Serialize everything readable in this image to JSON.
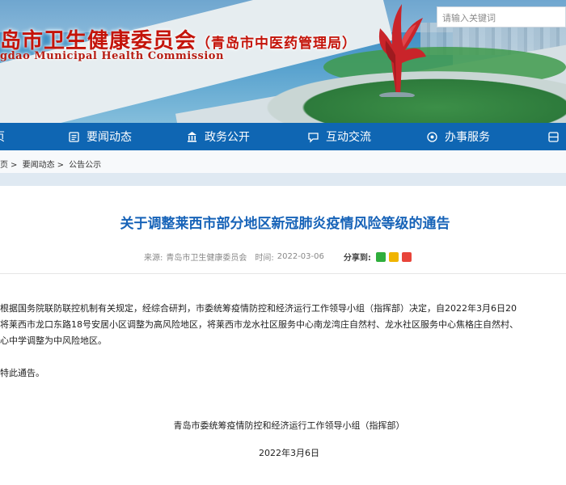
{
  "header": {
    "title_main": "岛市卫生健康委员会",
    "title_sub": "（青岛市中医药管理局）",
    "title_en": "gdao Municipal Health Commission",
    "search_placeholder": "请输入关键词"
  },
  "nav": {
    "items": [
      {
        "label": "页",
        "icon": "home-icon"
      },
      {
        "label": "要闻动态",
        "icon": "news-icon"
      },
      {
        "label": "政务公开",
        "icon": "gov-open-icon"
      },
      {
        "label": "互动交流",
        "icon": "chat-icon"
      },
      {
        "label": "办事服务",
        "icon": "service-icon"
      }
    ]
  },
  "breadcrumb": {
    "items": [
      "页",
      "要闻动态",
      "公告公示"
    ],
    "separator": ">"
  },
  "article": {
    "title": "关于调整莱西市部分地区新冠肺炎疫情风险等级的通告",
    "source_label": "来源:",
    "source": "青岛市卫生健康委员会",
    "time_label": "时间:",
    "time": "2022-03-06",
    "share_label": "分享到:",
    "share_icons": [
      "wechat-share-icon",
      "qzone-share-icon",
      "weibo-share-icon"
    ],
    "paragraph_lines": [
      "根据国务院联防联控机制有关规定，经综合研判，市委统筹疫情防控和经济运行工作领导小组（指挥部）决定，自2022年3月6日20",
      "将莱西市龙口东路18号安居小区调整为高风险地区，将莱西市龙水社区服务中心南龙湾庄自然村、龙水社区服务中心焦格庄自然村、",
      "心中学调整为中风险地区。"
    ],
    "closing": "特此通告。",
    "signature": "青岛市委统筹疫情防控和经济运行工作领导小组（指挥部）",
    "date": "2022年3月6日"
  },
  "colors": {
    "nav_bg": "#0f66b3",
    "title_blue": "#1763b8",
    "banner_red": "#c4140a"
  }
}
